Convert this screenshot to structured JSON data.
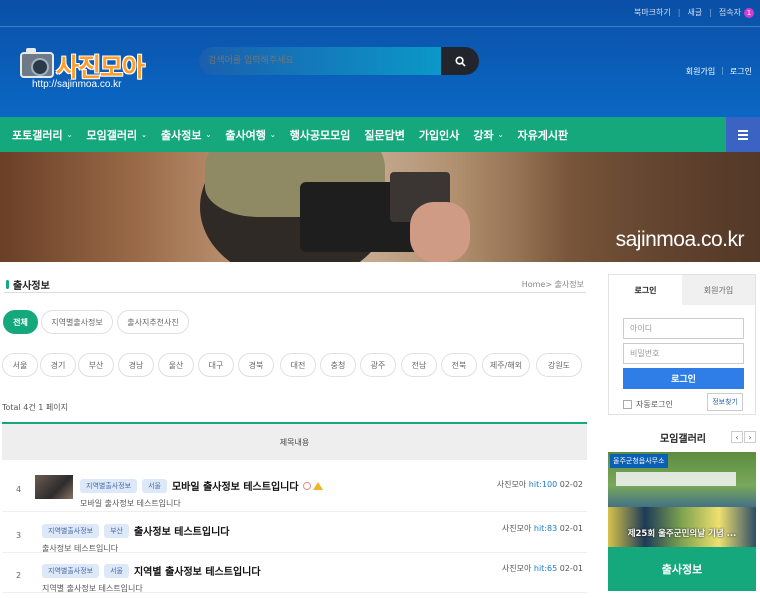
{
  "top_links": {
    "bookmark": "북마크하기",
    "new": "새글",
    "visitors": "접속자",
    "visitor_count": "1"
  },
  "logo": {
    "title": "사진모아",
    "url": "http://sajinmoa.co.kr"
  },
  "search": {
    "placeholder": "검색어를 입력해주세요"
  },
  "header_links": {
    "signup": "회원가입",
    "login": "로그인"
  },
  "nav": {
    "items": [
      {
        "label": "포토갤러리",
        "caret": true
      },
      {
        "label": "모임갤러리",
        "caret": true
      },
      {
        "label": "출사정보",
        "caret": true
      },
      {
        "label": "출사여행",
        "caret": true
      },
      {
        "label": "행사공모모임",
        "caret": false
      },
      {
        "label": "질문답변",
        "caret": false
      },
      {
        "label": "가입인사",
        "caret": false
      },
      {
        "label": "강좌",
        "caret": true
      },
      {
        "label": "자유게시판",
        "caret": false
      }
    ]
  },
  "banner": {
    "watermark": "sajinmoa.co.kr"
  },
  "section": {
    "title": "출사정보",
    "breadcrumb": "Home> 출사정보"
  },
  "tabs": [
    "전체",
    "지역별출사정보",
    "출사지추천사진"
  ],
  "regions": [
    "서울",
    "경기",
    "부산",
    "경남",
    "울산",
    "대구",
    "경북",
    "대전",
    "충청",
    "광주",
    "전남",
    "전북",
    "제주/해외",
    "강원도"
  ],
  "board": {
    "total": "Total 4건 1 페이지",
    "header": "제목내용",
    "rows": [
      {
        "num": "4",
        "tags": [
          "지역별출사정보",
          "서울"
        ],
        "title": "모바일 출사정보 테스트입니다",
        "sub": "모바일 출사정보 테스트입니다",
        "author": "사진모아",
        "hit": "hit:100",
        "date": "02-02"
      },
      {
        "num": "3",
        "tags": [
          "지역별출사정보",
          "부산"
        ],
        "title": "출사정보 테스트입니다",
        "sub": "출사정보 테스트입니다",
        "author": "사진모아",
        "hit": "hit:83",
        "date": "02-01"
      },
      {
        "num": "2",
        "tags": [
          "지역별출사정보",
          "서울"
        ],
        "title": "지역별 출사정보 테스트입니다",
        "sub": "지역별 출사정보 테스트입니다",
        "author": "사진모아",
        "hit": "hit:65",
        "date": "02-01"
      }
    ]
  },
  "sidebar": {
    "tab_login": "로그인",
    "tab_signup": "회원가입",
    "id_placeholder": "아이디",
    "pw_placeholder": "비밀번호",
    "login_button": "로그인",
    "auto_login": "자동로그인",
    "find_pw": "정보찾기",
    "gallery_title": "모임갤러리",
    "gallery_caption": "울주군청읍사무소",
    "gallery_photo_title": "제25회 울주군민의날 기념 ...",
    "green_box": "출사정보"
  },
  "colors": {
    "header": "#0a5fb8",
    "nav": "#14a87c",
    "menu_button": "#3b63c4",
    "login_button": "#2f7ee8"
  }
}
